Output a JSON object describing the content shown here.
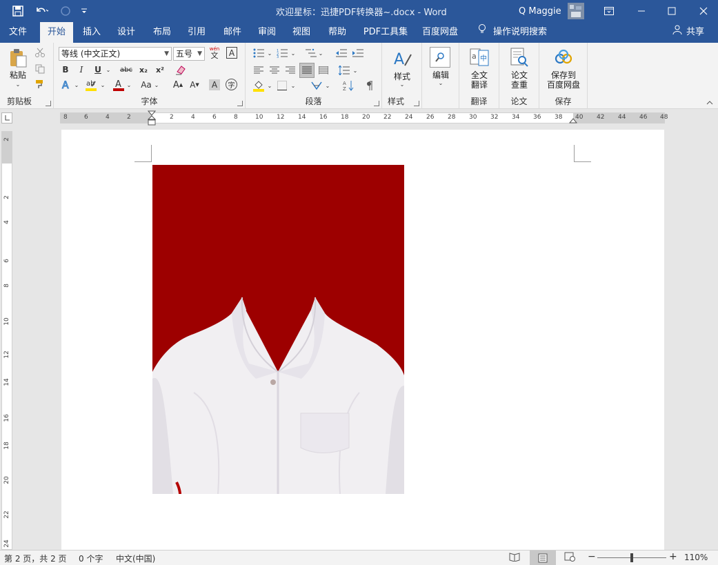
{
  "titlebar": {
    "title": "欢迎星标：迅捷PDF转换器~.docx  -  Word",
    "user": "Q Maggie",
    "colors": {
      "bar": "#2b579a",
      "text": "#ffffff"
    }
  },
  "tabs": [
    "文件",
    "开始",
    "插入",
    "设计",
    "布局",
    "引用",
    "邮件",
    "审阅",
    "视图",
    "帮助",
    "PDF工具集",
    "百度网盘"
  ],
  "active_tab": "开始",
  "tell_me": "操作说明搜索",
  "share": "共享",
  "ribbon": {
    "clipboard": {
      "label": "剪贴板",
      "paste": "粘贴"
    },
    "font": {
      "label": "字体",
      "font_name": "等线 (中文正文)",
      "font_size": "五号",
      "pinyin": "wén",
      "pinyin_char": "文",
      "border_char": "A",
      "bold": "B",
      "italic": "I",
      "underline": "U",
      "strike": "abc",
      "sub": "x₂",
      "sup": "x²",
      "case": "Aa",
      "grow": "A",
      "shrink": "A",
      "shade_char": "A",
      "enclose_char": "字"
    },
    "paragraph": {
      "label": "段落"
    },
    "styles": {
      "label": "样式",
      "button": "样式"
    },
    "editing": {
      "button": "编辑"
    },
    "translate": {
      "label": "翻译",
      "button": "全文\n翻译"
    },
    "paper": {
      "label": "论文",
      "button": "论文\n查重"
    },
    "save": {
      "label": "保存",
      "button": "保存到\n百度网盘"
    }
  },
  "ruler_h_ticks": [
    "8",
    "6",
    "4",
    "2",
    "2",
    "4",
    "6",
    "8",
    "10",
    "12",
    "14",
    "16",
    "18",
    "20",
    "22",
    "24",
    "26",
    "28",
    "30",
    "32",
    "34",
    "36",
    "38",
    "40",
    "42",
    "44",
    "46",
    "48"
  ],
  "ruler_v_ticks": [
    "2",
    "2",
    "4",
    "6",
    "8",
    "10",
    "12",
    "14",
    "16",
    "18",
    "20",
    "22",
    "24"
  ],
  "status": {
    "page": "第 2 页，共 2 页",
    "words": "0 个字",
    "lang": "中文(中国)",
    "zoom": "110%",
    "zoom_minus": "−",
    "zoom_plus": "+"
  },
  "photo": {
    "background": "#9d0000",
    "shirt": "#f2f0f2"
  }
}
